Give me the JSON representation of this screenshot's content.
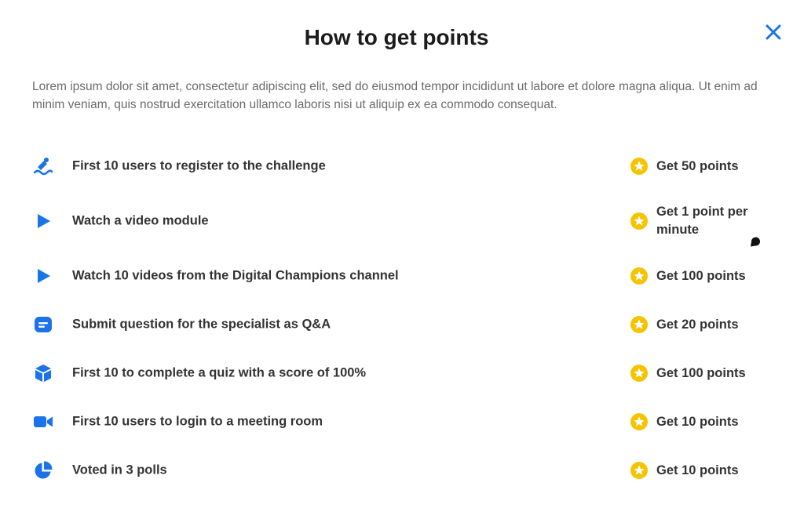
{
  "modal": {
    "title": "How to get points",
    "close_icon": "close-icon",
    "description": "Lorem ipsum dolor sit amet, consectetur adipiscing elit, sed do eiusmod tempor incididunt ut labore et dolore magna aliqua. Ut enim ad minim veniam, quis nostrud exercitation ullamco laboris nisi ut aliquip ex ea commodo consequat."
  },
  "colors": {
    "accent": "#1a73e8",
    "coin": "#f5c400",
    "text": "#333333",
    "muted": "#6b6b6b"
  },
  "rows": [
    {
      "icon": "register-icon",
      "label": "First 10 users to register to the challenge",
      "reward": "Get 50 points"
    },
    {
      "icon": "play-icon",
      "label": "Watch a video module",
      "reward": "Get 1 point per minute"
    },
    {
      "icon": "play-icon",
      "label": "Watch 10 videos from the Digital Champions channel",
      "reward": "Get 100 points"
    },
    {
      "icon": "message-icon",
      "label": "Submit question for the specialist as Q&A",
      "reward": "Get 20 points"
    },
    {
      "icon": "cube-icon",
      "label": "First 10 to complete a quiz with a score of 100%",
      "reward": "Get 100 points"
    },
    {
      "icon": "video-camera-icon",
      "label": "First 10 users to login to a meeting room",
      "reward": "Get 10 points"
    },
    {
      "icon": "pie-chart-icon",
      "label": "Voted in 3 polls",
      "reward": "Get 10 points"
    }
  ]
}
